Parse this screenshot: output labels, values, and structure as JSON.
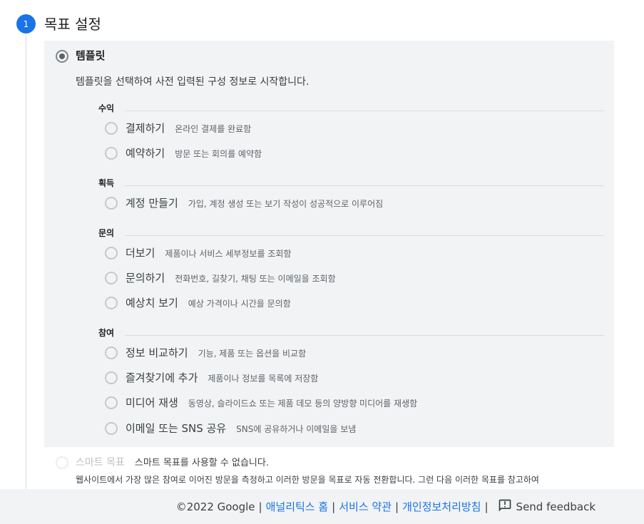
{
  "step": {
    "number": "1",
    "title": "목표 설정"
  },
  "template": {
    "label": "템플릿",
    "description": "템플릿을 선택하여 사전 입력된 구성 정보로 시작합니다."
  },
  "categories": [
    {
      "label": "수익",
      "options": [
        {
          "label": "결제하기",
          "desc": "온라인 결제를 완료함"
        },
        {
          "label": "예약하기",
          "desc": "방문 또는 회의를 예약함"
        }
      ]
    },
    {
      "label": "획득",
      "options": [
        {
          "label": "계정 만들기",
          "desc": "가입, 계정 생성 또는 보기 작성이 성공적으로 이루어짐"
        }
      ]
    },
    {
      "label": "문의",
      "options": [
        {
          "label": "더보기",
          "desc": "제품이나 서비스 세부정보를 조회함"
        },
        {
          "label": "문의하기",
          "desc": "전화번호, 길찾기, 채팅 또는 이메일을 조회함"
        },
        {
          "label": "예상치 보기",
          "desc": "예상 가격이나 시간을 문의함"
        }
      ]
    },
    {
      "label": "참여",
      "options": [
        {
          "label": "정보 비교하기",
          "desc": "기능, 제품 또는 옵션을 비교함"
        },
        {
          "label": "즐겨찾기에 추가",
          "desc": "제품이나 정보를 목록에 저장함"
        },
        {
          "label": "미디어 재생",
          "desc": "동영상, 슬라이드쇼 또는 제품 데모 등의 양방향 미디어를 재생함"
        },
        {
          "label": "이메일 또는 SNS 공유",
          "desc": "SNS에 공유하거나 이메일을 보냄"
        }
      ]
    }
  ],
  "smart_goal": {
    "label": "스마트 목표",
    "note": "스마트 목표를 사용할 수 없습니다.",
    "description": "웹사이트에서 가장 많은 참여로 이어진 방문을 측정하고 이러한 방문을 목표로 자동 전환합니다. 그런 다음 이러한 목표를 참고하여"
  },
  "footer": {
    "copyright": "©2022 Google",
    "links": [
      "애널리틱스 홈",
      "서비스 약관",
      "개인정보처리방침"
    ],
    "separator": "|",
    "feedback": "Send feedback"
  },
  "colors": {
    "accent": "#1a73e8",
    "panel": "#f1f3f4"
  }
}
